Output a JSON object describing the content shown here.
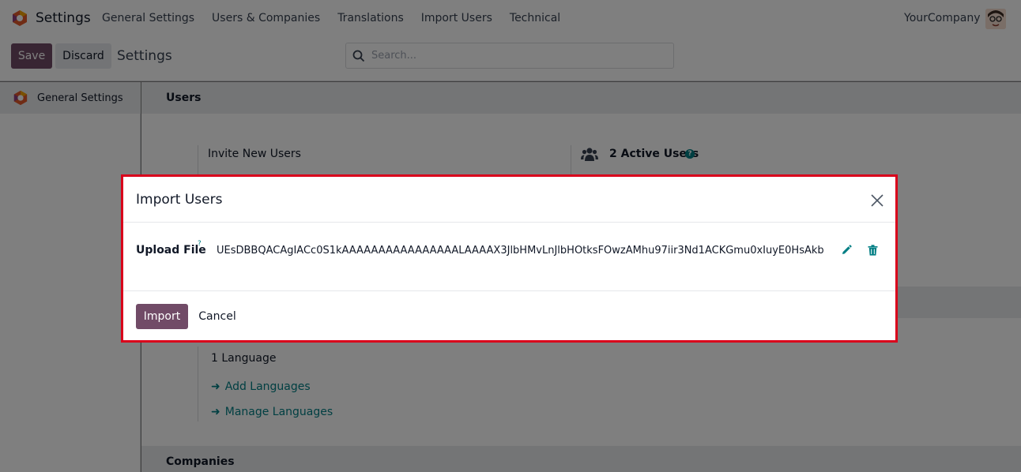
{
  "navbar": {
    "app_name": "Settings",
    "menu": [
      "General Settings",
      "Users & Companies",
      "Translations",
      "Import Users",
      "Technical"
    ],
    "company": "YourCompany"
  },
  "control": {
    "save_label": "Save",
    "discard_label": "Discard",
    "breadcrumb": "Settings",
    "search_placeholder": "Search..."
  },
  "sidebar": {
    "items": [
      {
        "label": "General Settings",
        "active": true
      }
    ]
  },
  "main": {
    "users_section": "Users",
    "invite_label": "Invite New Users",
    "active_users": "2 Active Users",
    "companies_section": "Companies",
    "language_count": "1 Language",
    "add_languages": "Add Languages",
    "manage_languages": "Manage Languages"
  },
  "dialog": {
    "title": "Import Users",
    "field_label": "Upload File",
    "field_help": "?",
    "file_value": "UEsDBBQACAgIACc0S1kAAAAAAAAAAAAAAAALAAAAX3JlbHMvLnJlbHOtksFOwzAMhu97iir3Nd1ACKGmu0xIuyE0HsAkb",
    "import_label": "Import",
    "cancel_label": "Cancel"
  },
  "colors": {
    "brand": "#714b67",
    "link": "#017e84",
    "highlight_border": "#d9001b"
  }
}
